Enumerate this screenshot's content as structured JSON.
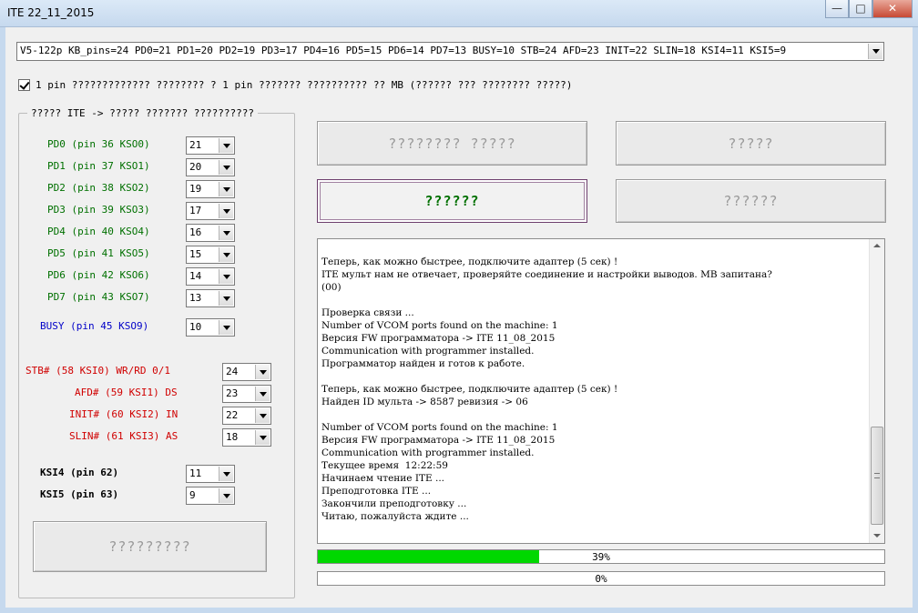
{
  "window": {
    "title": "ITE 22_11_2015"
  },
  "config": {
    "selected": "V5-122p KB_pins=24 PD0=21 PD1=20 PD2=19 PD3=17 PD4=16 PD5=15 PD6=14 PD7=13 BUSY=10 STB=24 AFD=23 INIT=22 SLIN=18 KSI4=11 KSI5=9"
  },
  "checkbox": {
    "label": "1 pin ????????????? ???????? ? 1 pin ??????? ?????????? ?? MB (?????? ??? ???????? ?????)",
    "checked": true
  },
  "group": {
    "title": "????? ITE -> ????? ??????? ??????????",
    "pins": [
      {
        "label": "PD0  (pin 36 KSO0)",
        "value": "21"
      },
      {
        "label": "PD1  (pin 37 KSO1)",
        "value": "20"
      },
      {
        "label": "PD2  (pin 38 KSO2)",
        "value": "19"
      },
      {
        "label": "PD3  (pin 39 KSO3)",
        "value": "17"
      },
      {
        "label": "PD4  (pin 40 KSO4)",
        "value": "16"
      },
      {
        "label": "PD5  (pin 41 KSO5)",
        "value": "15"
      },
      {
        "label": "PD6  (pin 42 KSO6)",
        "value": "14"
      },
      {
        "label": "PD7  (pin 43 KSO7)",
        "value": "13"
      }
    ],
    "busy": {
      "label": "BUSY  (pin 45 KSO9)",
      "value": "10"
    },
    "ctrl": [
      {
        "label": "STB# (58 KSI0) WR/RD 0/1",
        "value": "24"
      },
      {
        "label": "AFD# (59 KSI1) DS",
        "value": "23"
      },
      {
        "label": "INIT# (60 KSI2) IN",
        "value": "22"
      },
      {
        "label": "SLIN# (61 KSI3) AS",
        "value": "18"
      }
    ],
    "ksi": [
      {
        "label": "KSI4  (pin 62)",
        "value": "11"
      },
      {
        "label": "KSI5  (pin 63)",
        "value": "9"
      }
    ],
    "bottom_button": "?????????"
  },
  "buttons": {
    "b1": "???????? ?????",
    "b2": "?????",
    "b3": "??????",
    "b4": "??????"
  },
  "log": {
    "text": "Теперь, как можно быстрее, подключите адаптер (5 сек) !\nITE мульт нам не отвечает, проверяйте соединение и настройки выводов. MB запитана?\n(00)\n\nПроверка связи ...\nNumber of VCOM ports found on the machine: 1\nВерсия FW программатора -> ITE 11_08_2015\nCommunication with programmer installed.\nПрограмматор найден и готов к работе.\n\nТеперь, как можно быстрее, подключите адаптер (5 сек) !\nНайден ID мульта -> 8587 ревизия -> 06\n\nNumber of VCOM ports found on the machine: 1\nВерсия FW программатора -> ITE 11_08_2015\nCommunication with programmer installed.\nТекущее время  12:22:59\nНачинаем чтение ITE ...\nПреподготовка ITE ...\nЗакончили преподготовку ...\nЧитаю, пожалуйста ждите ..."
  },
  "progress1": {
    "label": "39%",
    "fraction": 0.39
  },
  "progress2": {
    "label": "0%",
    "fraction": 0
  },
  "colors": {
    "progress_fill": "#00d800",
    "pin_green": "#007000",
    "pin_blue": "#0000c8",
    "pin_red": "#d00000"
  }
}
